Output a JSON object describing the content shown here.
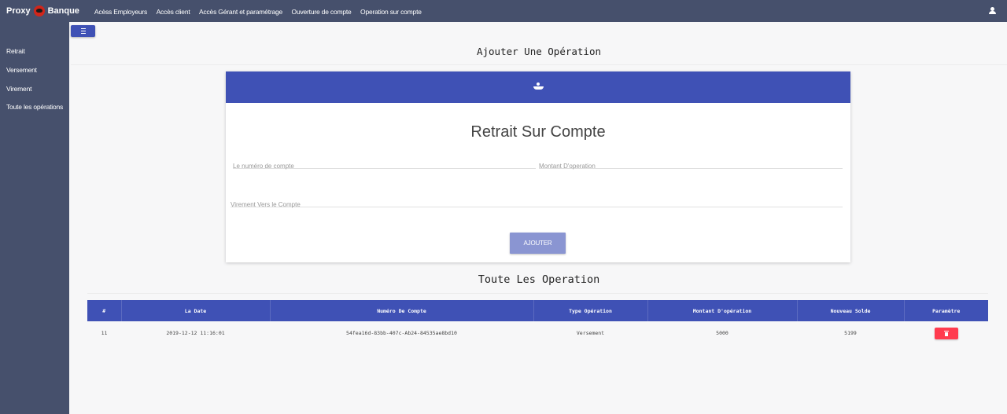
{
  "brand": {
    "left": "Proxy",
    "right": "Banque"
  },
  "nav": [
    "Acèss Employeurs",
    "Accès client",
    "Accès Gérant et paramétrage",
    "Ouverture de compte",
    "Operation sur compte"
  ],
  "sidebar": {
    "items": [
      "Retrait",
      "Versement",
      "Virement",
      "Toute les opérations"
    ]
  },
  "page": {
    "title": "Ajouter Une Opération"
  },
  "form": {
    "title": "Retrait Sur Compte",
    "account_placeholder": "Le numéro de compte",
    "amount_placeholder": "Montant D'operation",
    "transfer_placeholder": "Virement Vers le Compte",
    "submit_label": "AJOUTER"
  },
  "table": {
    "title": "Toute Les Operation",
    "headers": [
      "#",
      "La Date",
      "Numéro De Compte",
      "Type Opération",
      "Montant D'opération",
      "Nouveau Solde",
      "Paramètre"
    ],
    "rows": [
      {
        "id": "11",
        "date": "2019-12-12 11:16:01",
        "account": "54fea16d-83bb-407c-Ab24-84535ae8bd10",
        "type": "Versement",
        "amount": "5000",
        "balance": "5199"
      }
    ]
  },
  "colors": {
    "primary": "#3f51b5",
    "sidebar": "#46506c",
    "danger": "#ff3b4e",
    "button_muted": "#8a95d2"
  },
  "icons": [
    "user-icon",
    "menu-icon",
    "hand-coin-icon",
    "trash-icon",
    "logo-icon"
  ]
}
